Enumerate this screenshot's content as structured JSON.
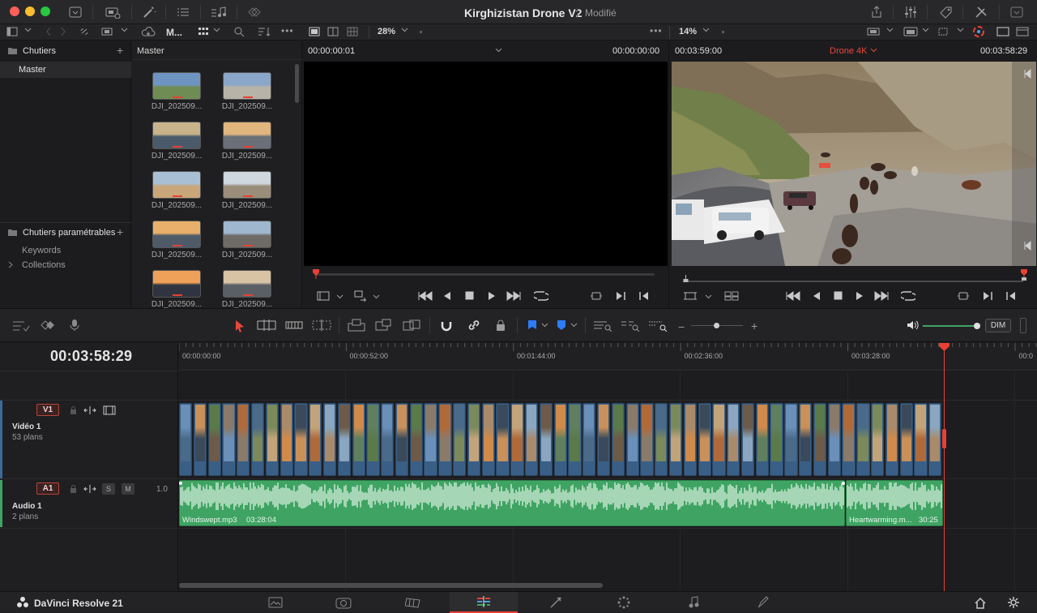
{
  "titlebar": {
    "project_name": "Kirghizistan Drone V2",
    "status": "Modifié"
  },
  "toolbar": {
    "media_pool_view": "M...",
    "source_zoom": "28%",
    "timeline_zoom": "14%",
    "more": "•••"
  },
  "bins": {
    "header": "Chutiers",
    "master": "Master",
    "smart_bins_header": "Chutiers paramétrables",
    "smart_bins": [
      "Keywords",
      "Collections"
    ]
  },
  "media_pool": {
    "header": "Master",
    "clips": [
      "DJI_202509...",
      "DJI_202509...",
      "DJI_202509...",
      "DJI_202509...",
      "DJI_202509...",
      "DJI_202509...",
      "DJI_202509...",
      "DJI_202509...",
      "DJI_202509...",
      "DJI_202509..."
    ]
  },
  "source_viewer": {
    "timecode_left": "00:00:00:01",
    "timecode_right": "00:00:00:00"
  },
  "timeline_viewer": {
    "timecode_left": "00:03:59:00",
    "timeline_name": "Drone 4K",
    "timecode_right": "00:03:58:29"
  },
  "audio": {
    "dim_label": "DIM"
  },
  "timeline": {
    "current_timecode": "00:03:58:29",
    "ruler": [
      "00:00:00:00",
      "00:00:52:00",
      "00:01:44:00",
      "00:02:36:00",
      "00:03:28:00",
      "00:0"
    ],
    "video_track": {
      "id": "V1",
      "name": "Vidéo 1",
      "count": "53 plans"
    },
    "audio_track": {
      "id": "A1",
      "name": "Audio 1",
      "count": "2 plans",
      "solo": "S",
      "mute": "M",
      "level": "1.0"
    },
    "audio_clips": [
      {
        "name": "Windswept.mp3",
        "duration": "03:28:04"
      },
      {
        "name": "Heartwarming.m...",
        "duration": "30:25"
      }
    ]
  },
  "footer": {
    "app_name": "DaVinci Resolve 21"
  },
  "colors": {
    "accent_red": "#e8483c",
    "audio_green": "#3fa463",
    "video_blue": "#3b6a98",
    "playhead": "#e84035"
  }
}
